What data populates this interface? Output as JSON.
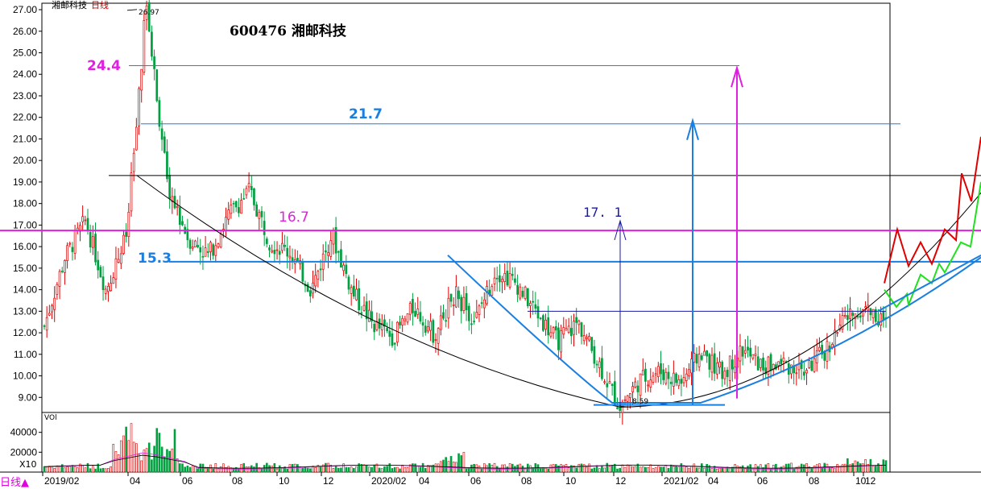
{
  "header": {
    "stock_name": "湘邮科技",
    "period": "日线",
    "title": "600476 湘邮科技"
  },
  "volume_panel": {
    "label": "VOl",
    "scale_label": "X10"
  },
  "bottom_tab": "日线▲",
  "annotations": {
    "level_24_4": "24.4",
    "level_21_7": "21.7",
    "level_16_7": "16.7",
    "level_15_3": "15.3",
    "level_17_1": "17. 1",
    "period_high": "26.97",
    "period_low": "8.59"
  },
  "colors": {
    "up": "#e00000",
    "down": "#00a040",
    "magenta": "#e020e0",
    "blue": "#1a7fe0",
    "navy": "#1a1aa0",
    "projection_red": "#e00000",
    "projection_green": "#20e020",
    "axis": "#000000"
  },
  "chart_data": {
    "type": "candlestick",
    "title": "600476 湘邮科技",
    "y_range": [
      8.3,
      27.3
    ],
    "y_ticks": [
      "9.00",
      "10.00",
      "11.00",
      "12.00",
      "13.00",
      "14.00",
      "15.00",
      "16.00",
      "17.00",
      "18.00",
      "19.00",
      "20.00",
      "21.00",
      "22.00",
      "23.00",
      "24.00",
      "25.00",
      "26.00",
      "27.00"
    ],
    "x_labels": [
      "2019/02",
      "04",
      "06",
      "08",
      "10",
      "12",
      "2020/02",
      "04",
      "06",
      "08",
      "10",
      "12",
      "2021/02",
      "04",
      "06",
      "08",
      "10",
      "12"
    ],
    "volume_ticks": [
      "20000",
      "40000"
    ],
    "volume_range": [
      0,
      60000
    ],
    "price_path": [
      [
        "2019-02",
        12.3
      ],
      [
        "2019-03",
        15.5
      ],
      [
        "2019-04",
        17.2
      ],
      [
        "2019-04b",
        14.0
      ],
      [
        "2019-05",
        16.5
      ],
      [
        "2019-05b",
        26.97
      ],
      [
        "2019-06",
        18.8
      ],
      [
        "2019-06b",
        16.4
      ],
      [
        "2019-07",
        15.6
      ],
      [
        "2019-08",
        17.5
      ],
      [
        "2019-09",
        18.6
      ],
      [
        "2019-10",
        16.2
      ],
      [
        "2019-11",
        15.7
      ],
      [
        "2019-12",
        14.0
      ],
      [
        "2019-12b",
        16.6
      ],
      [
        "2020-01",
        13.9
      ],
      [
        "2020-01b",
        12.4
      ],
      [
        "2020-02",
        11.8
      ],
      [
        "2020-03",
        13.2
      ],
      [
        "2020-04",
        11.9
      ],
      [
        "2020-05",
        13.8
      ],
      [
        "2020-06",
        12.6
      ],
      [
        "2020-07",
        14.9
      ],
      [
        "2020-08",
        14.3
      ],
      [
        "2020-09",
        12.9
      ],
      [
        "2020-10",
        11.6
      ],
      [
        "2020-11",
        12.5
      ],
      [
        "2020-12",
        10.6
      ],
      [
        "2021-01",
        8.59
      ],
      [
        "2021-02",
        9.8
      ],
      [
        "2021-03",
        10.2
      ],
      [
        "2021-04",
        9.7
      ],
      [
        "2021-05",
        11.1
      ],
      [
        "2021-06",
        10.1
      ],
      [
        "2021-07",
        11.2
      ],
      [
        "2021-08",
        10.4
      ],
      [
        "2021-09",
        10.6
      ],
      [
        "2021-10",
        10.2
      ],
      [
        "2021-11",
        11.1
      ],
      [
        "2021-12",
        12.6
      ],
      [
        "2021-12b",
        13.2
      ],
      [
        "2022-01",
        12.4
      ]
    ],
    "horizontal_levels": [
      {
        "label": "24.4",
        "value": 24.4,
        "color": "#e020e0"
      },
      {
        "label": "21.7",
        "value": 21.7,
        "color": "#1a7fe0"
      },
      {
        "label": "16.7",
        "value": 16.75,
        "color": "#e020e0"
      },
      {
        "label": "15.3",
        "value": 15.3,
        "color": "#1a7fe0"
      },
      {
        "value": 19.3,
        "color": "#000000"
      },
      {
        "value": 13.0,
        "color": "#1a1aa0"
      }
    ],
    "grid": false
  }
}
